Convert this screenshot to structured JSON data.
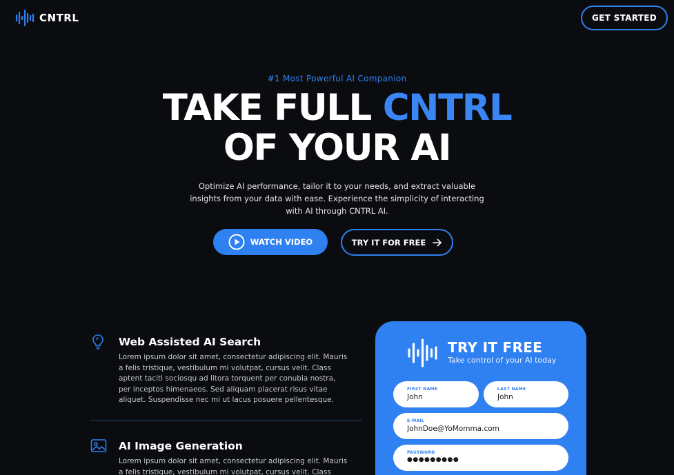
{
  "nav": {
    "brand": "CNTRL",
    "cta_label": "GET STARTED"
  },
  "hero": {
    "eyebrow": "#1 Most Powerful AI Companion",
    "headline_part1": "TAKE FULL ",
    "headline_accent": "CNTRL",
    "headline_line2": "OF YOUR AI",
    "subtitle": "Optimize AI performance, tailor it to your needs, and extract valuable insights from your data with ease. Experience the simplicity of interacting with AI through CNTRL AI.",
    "watch_video_label": "WATCH VIDEO",
    "try_free_label": "TRY IT FOR FREE"
  },
  "features": [
    {
      "icon": "lightbulb-icon",
      "title": "Web Assisted AI Search",
      "body": "Lorem ipsum dolor sit amet, consectetur adipiscing elit. Mauris a felis tristique, vestibulum mi volutpat, cursus velit. Class aptent taciti sociosqu ad litora torquent per conubia nostra, per inceptos himenaeos. Sed aliquam placerat risus vitae aliquet. Suspendisse nec mi ut lacus posuere pellentesque."
    },
    {
      "icon": "image-icon",
      "title": "AI Image Generation",
      "body": "Lorem ipsum dolor sit amet, consectetur adipiscing elit. Mauris a felis tristique, vestibulum mi volutpat, cursus velit. Class aptent taciti"
    }
  ],
  "signup": {
    "title": "TRY IT FREE",
    "subtitle": "Take control of your AI today",
    "first_name_label": "FIRST NAME",
    "first_name_value": "John",
    "last_name_label": "LAST NAME",
    "last_name_value": "John",
    "email_label": "E-MAIL",
    "email_value": "JohnDoe@YoMomma.com",
    "password_label": "PASSWORD",
    "password_value": "●●●●●●●●●"
  },
  "colors": {
    "accent": "#2f80f0",
    "background": "#0b0c10"
  }
}
